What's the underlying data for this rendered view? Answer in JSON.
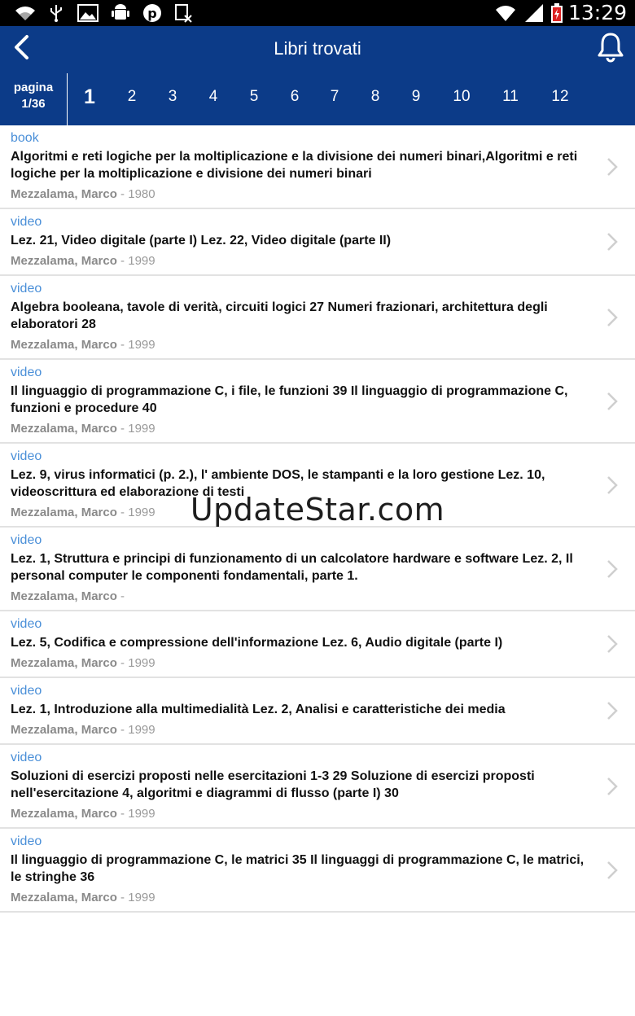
{
  "status_bar": {
    "time": "13:29",
    "icons": [
      "wifi-signal-icon",
      "usb-icon",
      "image-icon",
      "android-debug-icon",
      "pinterest-icon",
      "app-notification-icon",
      "wifi-icon",
      "cell-signal-icon",
      "battery-charging-icon"
    ]
  },
  "header": {
    "title": "Libri trovati",
    "back_icon": "back-chevron-icon",
    "bell_icon": "bell-icon"
  },
  "pagination": {
    "label": "pagina",
    "current": "1/36",
    "pages": [
      "1",
      "2",
      "3",
      "4",
      "5",
      "6",
      "7",
      "8",
      "9",
      "10",
      "11",
      "12"
    ],
    "active": "1"
  },
  "results": [
    {
      "type": "book",
      "title": "Algoritmi e reti logiche per la moltiplicazione e la divisione dei numeri binari,Algoritmi e reti logiche per la moltiplicazione e divisione dei numeri binari",
      "author": "Mezzalama, Marco",
      "year": " - 1980"
    },
    {
      "type": "video",
      "title": "Lez. 21, Video digitale (parte I) Lez. 22, Video digitale (parte II)",
      "author": "Mezzalama, Marco",
      "year": " - 1999"
    },
    {
      "type": "video",
      "title": "Algebra booleana, tavole di verità, circuiti logici 27 Numeri frazionari, architettura degli elaboratori 28",
      "author": "Mezzalama, Marco",
      "year": " - 1999"
    },
    {
      "type": "video",
      "title": "Il linguaggio di programmazione C, i file, le funzioni 39 Il linguaggio di programmazione C, funzioni e procedure 40",
      "author": "Mezzalama, Marco",
      "year": " - 1999"
    },
    {
      "type": "video",
      "title": "Lez. 9, virus informatici (p. 2.), l' ambiente DOS, le stampanti e la loro gestione Lez. 10, videoscrittura ed elaborazione di testi",
      "author": "Mezzalama, Marco",
      "year": " - 1999"
    },
    {
      "type": "video",
      "title": "Lez. 1, Struttura e principi di funzionamento di un calcolatore hardware e software Lez. 2, Il personal computer le componenti fondamentali, parte 1.",
      "author": "Mezzalama, Marco",
      "year": " -"
    },
    {
      "type": "video",
      "title": "Lez. 5, Codifica e compressione dell'informazione Lez. 6, Audio digitale (parte I)",
      "author": "Mezzalama, Marco",
      "year": " - 1999"
    },
    {
      "type": "video",
      "title": "Lez. 1, Introduzione alla multimedialità Lez. 2, Analisi e caratteristiche dei media",
      "author": "Mezzalama, Marco",
      "year": " - 1999"
    },
    {
      "type": "video",
      "title": "Soluzioni di esercizi proposti nelle esercitazioni 1-3 29 Soluzione di esercizi proposti nell'esercitazione 4, algoritmi e diagrammi di flusso (parte I) 30",
      "author": "Mezzalama, Marco",
      "year": " - 1999"
    },
    {
      "type": "video",
      "title": "Il linguaggio di programmazione C, le matrici 35 Il linguaggi di programmazione C, le matrici, le stringhe 36",
      "author": "Mezzalama, Marco",
      "year": " - 1999"
    }
  ],
  "watermark": "UpdateStar.com",
  "colors": {
    "header_bg": "#0c3b88",
    "type_label": "#4a8fd8",
    "meta": "#8a8a8a",
    "divider": "#e2e2e2"
  }
}
